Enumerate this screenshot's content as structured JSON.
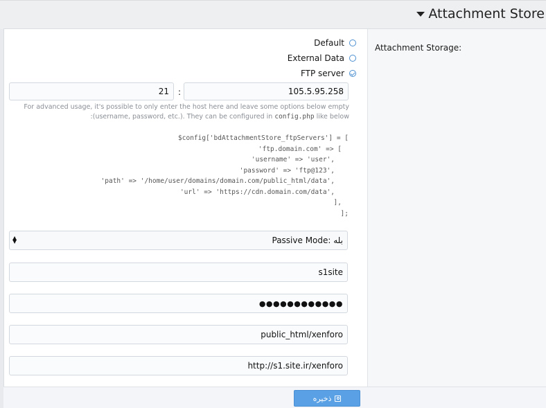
{
  "header": {
    "title": "Attachment Store"
  },
  "form": {
    "label": "Attachment Storage:",
    "radios": [
      {
        "label": "Default",
        "checked": false
      },
      {
        "label": "External Data",
        "checked": false
      },
      {
        "label": "FTP server",
        "checked": true
      }
    ],
    "host": "105.5.95.258",
    "port": "21",
    "colon": ":",
    "help_pre": "For advanced usage, it's possible to only enter the host here and leave some options below empty (username, password, etc.). They can be configured in",
    "help_code": "config.php",
    "help_post": "like below:",
    "code_lines": [
      "$config['bdAttachmentStore_ftpServers'] = [",
      "'ftp.domain.com' => [",
      "'username' => 'user',",
      "'password' => 'ftp@123',",
      "'path' => '/home/user/domains/domain.com/public_html/data',",
      "'url' => 'https://cdn.domain.com/data',",
      "],",
      "];"
    ],
    "passive_select": "Passive Mode: بله",
    "username": "s1site",
    "password": "●●●●●●●●●●●●",
    "path": "public_html/xenforo",
    "url": "http://s1.site.ir/xenforo"
  },
  "footer": {
    "save_label": "ذخیره"
  }
}
